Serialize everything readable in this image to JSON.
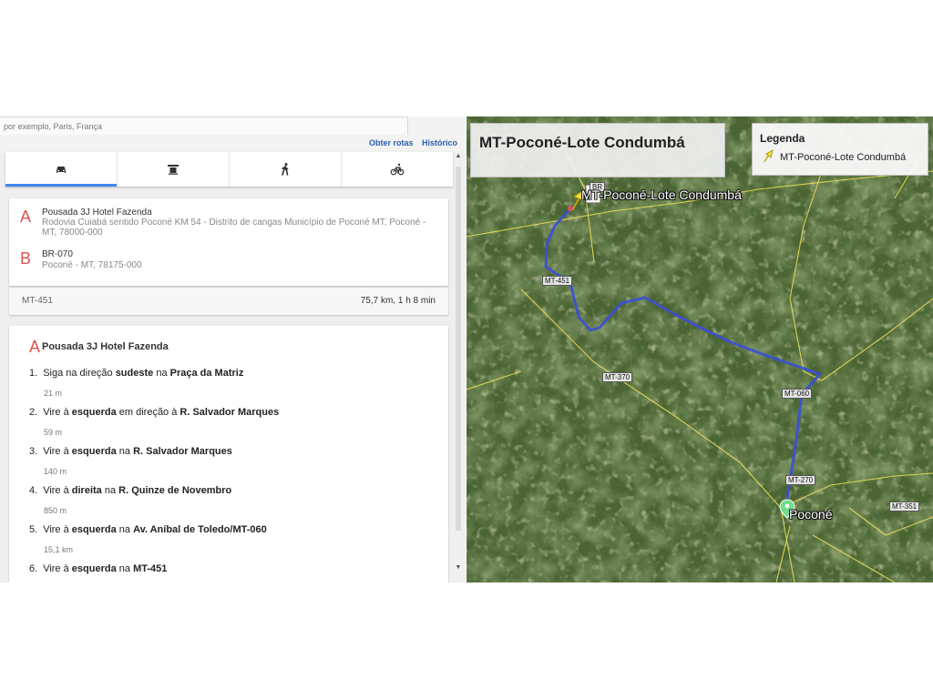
{
  "search": {
    "placeholder": "por exemplo, Paris, França"
  },
  "top_links": {
    "directions": "Obter rotas",
    "history": "Histórico"
  },
  "modes": [
    {
      "name": "car-icon",
      "active": true
    },
    {
      "name": "transit-icon",
      "active": false
    },
    {
      "name": "walk-icon",
      "active": false
    },
    {
      "name": "bike-icon",
      "active": false
    }
  ],
  "route": {
    "origin_letter": "A",
    "origin_name": "Pousada 3J Hotel Fazenda",
    "origin_address": "Rodovia Cuiabá sentido Poconé KM 54 - Distrito de cangas Município de Poconé MT, Poconé - MT, 78000-000",
    "dest_letter": "B",
    "dest_name": "BR-070",
    "dest_address": "Poconé - MT, 78175-000",
    "summary_road": "MT-451",
    "summary_distance": "75,7 km, 1 h 8 min"
  },
  "steps_header": {
    "letter": "A",
    "name": "Pousada 3J Hotel Fazenda"
  },
  "steps": [
    {
      "num": "1.",
      "parts": [
        [
          "t",
          "Siga na direção "
        ],
        [
          "b",
          "sudeste"
        ],
        [
          "t",
          " na "
        ],
        [
          "b",
          "Praça da Matriz"
        ]
      ],
      "dist": "21 m"
    },
    {
      "num": "2.",
      "parts": [
        [
          "t",
          "Vire à "
        ],
        [
          "b",
          "esquerda"
        ],
        [
          "t",
          " em direção à "
        ],
        [
          "b",
          "R. Salvador Marques"
        ]
      ],
      "dist": "59 m"
    },
    {
      "num": "3.",
      "parts": [
        [
          "t",
          "Vire à "
        ],
        [
          "b",
          "esquerda"
        ],
        [
          "t",
          " na "
        ],
        [
          "b",
          "R. Salvador Marques"
        ]
      ],
      "dist": "140 m"
    },
    {
      "num": "4.",
      "parts": [
        [
          "t",
          "Vire à "
        ],
        [
          "b",
          "direita"
        ],
        [
          "t",
          " na "
        ],
        [
          "b",
          "R. Quinze de Novembro"
        ]
      ],
      "dist": "850 m"
    },
    {
      "num": "5.",
      "parts": [
        [
          "t",
          "Vire à "
        ],
        [
          "b",
          "esquerda"
        ],
        [
          "t",
          " na "
        ],
        [
          "b",
          "Av. Aníbal de Toledo/MT-060"
        ]
      ],
      "dist": "15,1 km"
    },
    {
      "num": "6.",
      "parts": [
        [
          "t",
          "Vire à "
        ],
        [
          "b",
          "esquerda"
        ],
        [
          "t",
          " na "
        ],
        [
          "b",
          "MT-451"
        ]
      ],
      "dist": ""
    }
  ],
  "map": {
    "title": "MT-Poconé-Lote Condumbá",
    "legend_title": "Legenda",
    "legend_item": "MT-Poconé-Lote Condumbá",
    "place_top": "MT-Poconé-Lote Condumbá",
    "place_town": "Poconé",
    "road_labels": {
      "mt451": "MT-451",
      "mt370": "MT-370",
      "mt060": "MT-060",
      "mt270": "MT-270",
      "mt351": "MT-351",
      "br": "BR"
    },
    "route_color": "#3a4fd6",
    "road_color": "#f0e45a",
    "pin_color": "#f4e23a",
    "town_marker_color": "#6fdc8c"
  }
}
